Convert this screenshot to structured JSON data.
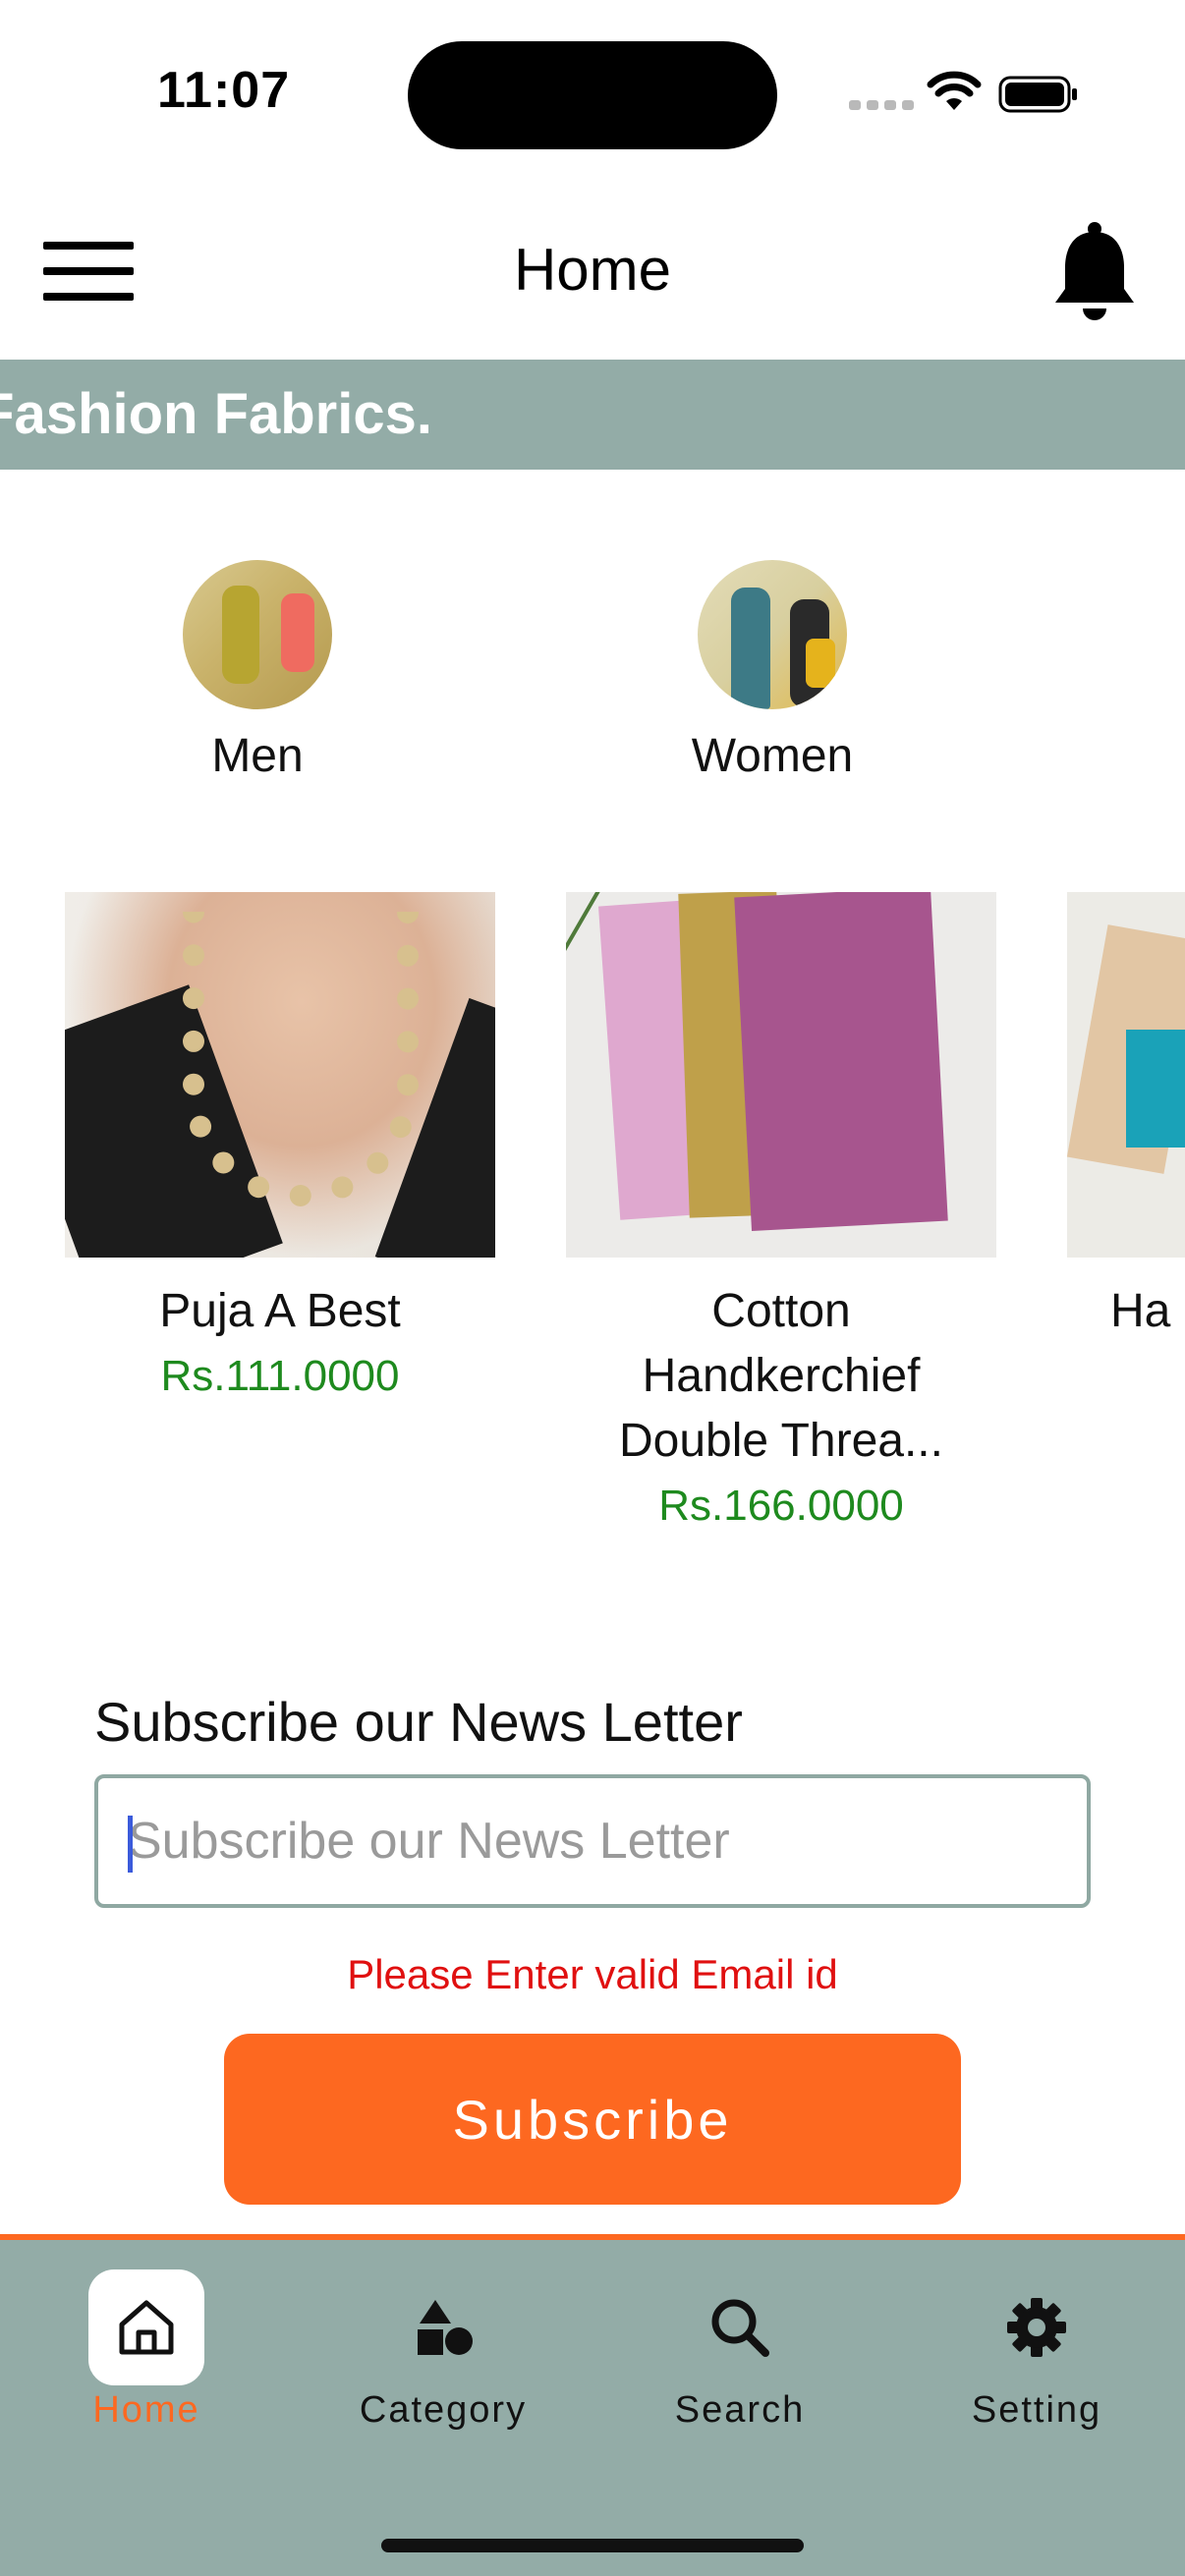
{
  "status_bar": {
    "time": "11:07"
  },
  "header": {
    "title": "Home"
  },
  "marquee": {
    "text": "Fashion Fabrics."
  },
  "categories": [
    {
      "label": "Men"
    },
    {
      "label": "Women"
    }
  ],
  "products": [
    {
      "name": "Puja A Best",
      "price": "Rs.111.0000"
    },
    {
      "name": "Cotton Handkerchief Double Threa...",
      "price": "Rs.166.0000"
    },
    {
      "name": "Ha",
      "price": ""
    }
  ],
  "newsletter": {
    "title": "Subscribe our News Letter",
    "placeholder": "Subscribe our News Letter",
    "error": "Please Enter valid Email id",
    "button_label": "Subscribe"
  },
  "bottom_nav": {
    "items": [
      {
        "label": "Home",
        "icon": "home-icon",
        "active": true
      },
      {
        "label": "Category",
        "icon": "category-icon",
        "active": false
      },
      {
        "label": "Search",
        "icon": "search-icon",
        "active": false
      },
      {
        "label": "Setting",
        "icon": "gear-icon",
        "active": false
      }
    ]
  },
  "colors": {
    "accent": "#fd6820",
    "nav_background": "#93aca7",
    "price": "#1e8a1e",
    "error": "#e01010"
  }
}
